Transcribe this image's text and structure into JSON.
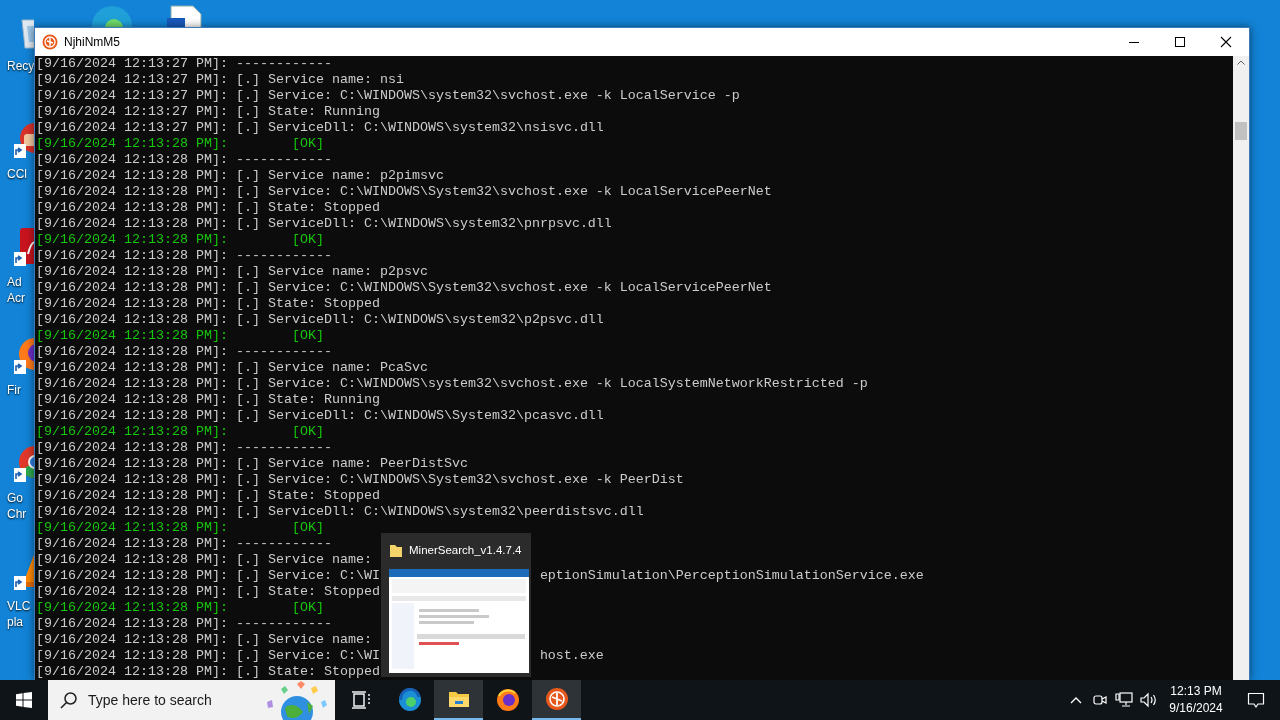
{
  "desktop": {
    "icons": [
      {
        "kind": "recycle",
        "label": [
          "Recy"
        ]
      },
      {
        "kind": "cleaner",
        "label": [
          "CCl"
        ]
      },
      {
        "kind": "pdf",
        "label": [
          "Ad",
          "Acr"
        ]
      },
      {
        "kind": "firefox",
        "label": [
          "Fir"
        ]
      },
      {
        "kind": "chrome",
        "label": [
          "Go",
          "Chr"
        ]
      },
      {
        "kind": "vlc",
        "label": [
          "VLC",
          "pla"
        ]
      }
    ]
  },
  "window": {
    "title": "NjhiNmM5",
    "lines": [
      {
        "kind": "log",
        "text": "[9/16/2024 12:13:27 PM]: ------------"
      },
      {
        "kind": "log",
        "text": "[9/16/2024 12:13:27 PM]: [.] Service name: nsi"
      },
      {
        "kind": "log",
        "text": "[9/16/2024 12:13:27 PM]: [.] Service: C:\\WINDOWS\\system32\\svchost.exe -k LocalService -p"
      },
      {
        "kind": "log",
        "text": "[9/16/2024 12:13:27 PM]: [.] State: Running"
      },
      {
        "kind": "log",
        "text": "[9/16/2024 12:13:27 PM]: [.] ServiceDll: C:\\WINDOWS\\system32\\nsisvc.dll"
      },
      {
        "kind": "ok",
        "text": "[9/16/2024 12:13:28 PM]:        [OK]"
      },
      {
        "kind": "log",
        "text": "[9/16/2024 12:13:28 PM]: ------------"
      },
      {
        "kind": "log",
        "text": "[9/16/2024 12:13:28 PM]: [.] Service name: p2pimsvc"
      },
      {
        "kind": "log",
        "text": "[9/16/2024 12:13:28 PM]: [.] Service: C:\\WINDOWS\\System32\\svchost.exe -k LocalServicePeerNet"
      },
      {
        "kind": "log",
        "text": "[9/16/2024 12:13:28 PM]: [.] State: Stopped"
      },
      {
        "kind": "log",
        "text": "[9/16/2024 12:13:28 PM]: [.] ServiceDll: C:\\WINDOWS\\system32\\pnrpsvc.dll"
      },
      {
        "kind": "ok",
        "text": "[9/16/2024 12:13:28 PM]:        [OK]"
      },
      {
        "kind": "log",
        "text": "[9/16/2024 12:13:28 PM]: ------------"
      },
      {
        "kind": "log",
        "text": "[9/16/2024 12:13:28 PM]: [.] Service name: p2psvc"
      },
      {
        "kind": "log",
        "text": "[9/16/2024 12:13:28 PM]: [.] Service: C:\\WINDOWS\\System32\\svchost.exe -k LocalServicePeerNet"
      },
      {
        "kind": "log",
        "text": "[9/16/2024 12:13:28 PM]: [.] State: Stopped"
      },
      {
        "kind": "log",
        "text": "[9/16/2024 12:13:28 PM]: [.] ServiceDll: C:\\WINDOWS\\system32\\p2psvc.dll"
      },
      {
        "kind": "ok",
        "text": "[9/16/2024 12:13:28 PM]:        [OK]"
      },
      {
        "kind": "log",
        "text": "[9/16/2024 12:13:28 PM]: ------------"
      },
      {
        "kind": "log",
        "text": "[9/16/2024 12:13:28 PM]: [.] Service name: PcaSvc"
      },
      {
        "kind": "log",
        "text": "[9/16/2024 12:13:28 PM]: [.] Service: C:\\WINDOWS\\system32\\svchost.exe -k LocalSystemNetworkRestricted -p"
      },
      {
        "kind": "log",
        "text": "[9/16/2024 12:13:28 PM]: [.] State: Running"
      },
      {
        "kind": "log",
        "text": "[9/16/2024 12:13:28 PM]: [.] ServiceDll: C:\\WINDOWS\\System32\\pcasvc.dll"
      },
      {
        "kind": "ok",
        "text": "[9/16/2024 12:13:28 PM]:        [OK]"
      },
      {
        "kind": "log",
        "text": "[9/16/2024 12:13:28 PM]: ------------"
      },
      {
        "kind": "log",
        "text": "[9/16/2024 12:13:28 PM]: [.] Service name: PeerDistSvc"
      },
      {
        "kind": "log",
        "text": "[9/16/2024 12:13:28 PM]: [.] Service: C:\\WINDOWS\\System32\\svchost.exe -k PeerDist"
      },
      {
        "kind": "log",
        "text": "[9/16/2024 12:13:28 PM]: [.] State: Stopped"
      },
      {
        "kind": "log",
        "text": "[9/16/2024 12:13:28 PM]: [.] ServiceDll: C:\\WINDOWS\\system32\\peerdistsvc.dll"
      },
      {
        "kind": "ok",
        "text": "[9/16/2024 12:13:28 PM]:        [OK]"
      },
      {
        "kind": "log",
        "text": "[9/16/2024 12:13:28 PM]: ------------"
      },
      {
        "kind": "log",
        "text": "[9/16/2024 12:13:28 PM]: [.] Service name:"
      },
      {
        "kind": "log",
        "text": "[9/16/2024 12:13:28 PM]: [.] Service: C:\\WI",
        "rest": "eptionSimulation\\PerceptionSimulationService.exe"
      },
      {
        "kind": "log",
        "text": "[9/16/2024 12:13:28 PM]: [.] State: Stopped"
      },
      {
        "kind": "ok",
        "text": "[9/16/2024 12:13:28 PM]:        [OK]"
      },
      {
        "kind": "log",
        "text": "[9/16/2024 12:13:28 PM]: ------------"
      },
      {
        "kind": "log",
        "text": "[9/16/2024 12:13:28 PM]: [.] Service name:"
      },
      {
        "kind": "log",
        "text": "[9/16/2024 12:13:28 PM]: [.] Service: C:\\WI",
        "rest": "host.exe"
      },
      {
        "kind": "log",
        "text": "[9/16/2024 12:13:28 PM]: [.] State: Stopped"
      }
    ]
  },
  "preview": {
    "title": "MinerSearch_v1.4.7.4"
  },
  "taskbar": {
    "search": {
      "placeholder": "Type here to search"
    },
    "apps": [
      {
        "kind": "taskview",
        "open": false,
        "highlighted": false
      },
      {
        "kind": "edge",
        "open": false,
        "highlighted": false
      },
      {
        "kind": "explorer",
        "open": true,
        "highlighted": true
      },
      {
        "kind": "firefox",
        "open": false,
        "highlighted": false
      },
      {
        "kind": "logo",
        "open": true,
        "highlighted": true
      }
    ],
    "clock": {
      "time": "12:13 PM",
      "date": "9/16/2024"
    }
  }
}
